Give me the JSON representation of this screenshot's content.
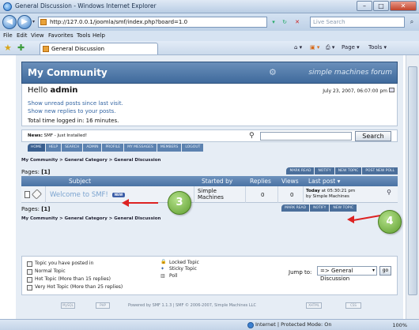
{
  "window": {
    "title": "General Discussion - Windows Internet Explorer",
    "minimize": "–",
    "maximize": "□",
    "close": "✕"
  },
  "address": {
    "back": "◀",
    "forward": "▶",
    "url": "http://127.0.0.1/joomla/smf/index.php?board=1.0",
    "live_search_placeholder": "Live Search"
  },
  "menu": [
    "File",
    "Edit",
    "View",
    "Favorites",
    "Tools",
    "Help"
  ],
  "favbar": {
    "tab_title": "General Discussion",
    "commands": [
      "Page ▾",
      "Tools ▾"
    ]
  },
  "forum": {
    "site_title": "My Community",
    "brand": "simple machines forum",
    "hello_prefix": "Hello ",
    "username": "admin",
    "date": "July 23, 2007, 06:07:00 pm",
    "unread_link": "Show unread posts since last visit.",
    "replies_link": "Show new replies to your posts.",
    "time_logged": "Total time logged in: 16 minutes.",
    "news_label": "News:",
    "news_text": " SMF - Just Installed!",
    "search_button": "Search",
    "main_menu": [
      "HOME",
      "HELP",
      "SEARCH",
      "ADMIN",
      "PROFILE",
      "MY MESSAGES",
      "MEMBERS",
      "LOGOUT"
    ],
    "breadcrumb": "My Community > General Category > General Discussion",
    "pages_label": "Pages: ",
    "pages_value": "[1]",
    "top_buttons": [
      "MARK READ",
      "NOTIFY",
      "NEW TOPIC",
      "POST NEW POLL"
    ],
    "bottom_buttons": [
      "MARK READ",
      "NOTIFY",
      "NEW TOPIC"
    ],
    "columns": [
      "Subject",
      "Started by",
      "Replies",
      "Views",
      "Last post ▾"
    ],
    "topics": [
      {
        "subject": "Welcome to SMF!",
        "badge": "NEW",
        "started_by_line1": "Simple",
        "started_by_line2": "Machines",
        "replies": "0",
        "views": "0",
        "last_post_day": "Today",
        "last_post_time": " at 05:30:21 pm",
        "last_post_by": "by Simple Machines"
      }
    ],
    "legend": [
      "Topic you have posted in",
      "Normal Topic",
      "Hot Topic (More than 15 replies)",
      "Very Hot Topic (More than 25 replies)"
    ],
    "legend_right": [
      "Locked Topic",
      "Sticky Topic",
      "Poll"
    ],
    "jump_to_label": "Jump to:",
    "jump_to_value": "=> General Discussion",
    "go_button": "go",
    "footer_text": "Powered by SMF 1.1.3 | SMF © 2006-2007, Simple Machines LLC",
    "footer_badges": [
      "MySQL",
      "PHP",
      "XHTML",
      "CSS"
    ]
  },
  "callouts": [
    "3",
    "4"
  ],
  "status": {
    "zone": "Internet | Protected Mode: On",
    "zoom": "100%"
  }
}
